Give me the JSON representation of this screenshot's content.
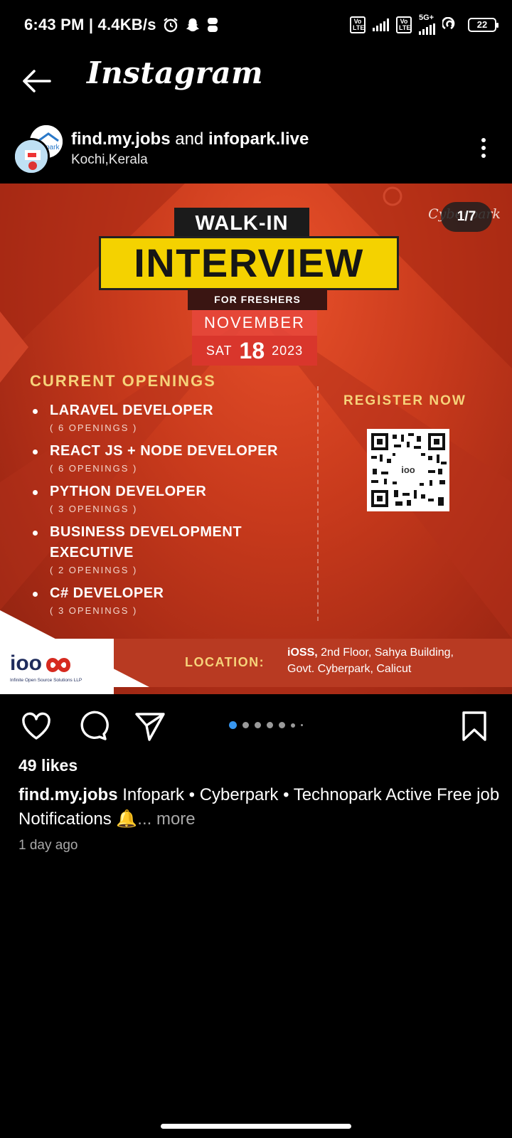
{
  "status_bar": {
    "time_speed": "6:43 PM | 4.4KB/s",
    "volte1": "Vo LTE",
    "volte2": "Vo LTE",
    "network": "5G+",
    "battery": "22"
  },
  "header": {
    "app_title": "Instagram"
  },
  "post": {
    "owners_primary": "find.my.jobs",
    "owners_and": "and",
    "owners_secondary": "infopark.live",
    "location": "Kochi,Kerala",
    "slide_counter": "1/7",
    "image": {
      "walkin": "WALK-IN",
      "interview": "INTERVIEW",
      "freshers": "FOR FRESHERS",
      "month": "NOVEMBER",
      "day_of_week": "SAT",
      "day": "18",
      "year": "2023",
      "openings_title": "CURRENT OPENINGS",
      "jobs": [
        {
          "title": "LARAVEL DEVELOPER",
          "count": "( 6 OPENINGS )"
        },
        {
          "title": "REACT JS + NODE DEVELOPER",
          "count": "( 6 OPENINGS )"
        },
        {
          "title": "PYTHON DEVELOPER",
          "count": "( 3 OPENINGS )"
        },
        {
          "title": "BUSINESS DEVELOPMENT EXECUTIVE",
          "count": "( 2 OPENINGS )"
        },
        {
          "title": "C# DEVELOPER",
          "count": "( 3 OPENINGS )"
        }
      ],
      "register": "REGISTER NOW",
      "qr_center": "ioo",
      "location_label": "LOCATION:",
      "address_bold": "iOSS,",
      "address_line1": "2nd Floor, Sahya Building,",
      "address_line2": "Govt. Cyberpark, Calicut",
      "company_logo_text": "ioo",
      "company_name": "Infinite Open Source Solutions LLP",
      "cyberpark_logo": "Cyberpark"
    },
    "likes": "49 likes",
    "caption_user": "find.my.jobs",
    "caption_text": "Infopark • Cyberpark • Technopark Active Free job Notifications 🔔",
    "caption_more": "... more",
    "time_ago": "1 day ago",
    "carousel": {
      "total": 7,
      "active": 1
    }
  },
  "icons": {
    "back": "arrow-left-icon",
    "like": "heart-icon",
    "comment": "comment-icon",
    "share": "send-icon",
    "save": "bookmark-icon",
    "more": "more-vertical-icon"
  },
  "colors": {
    "background": "#000000",
    "poster_red": "#c83a1c",
    "poster_yellow": "#f4d200",
    "accent_gold": "#f6d37a",
    "carousel_active": "#3897f0"
  }
}
